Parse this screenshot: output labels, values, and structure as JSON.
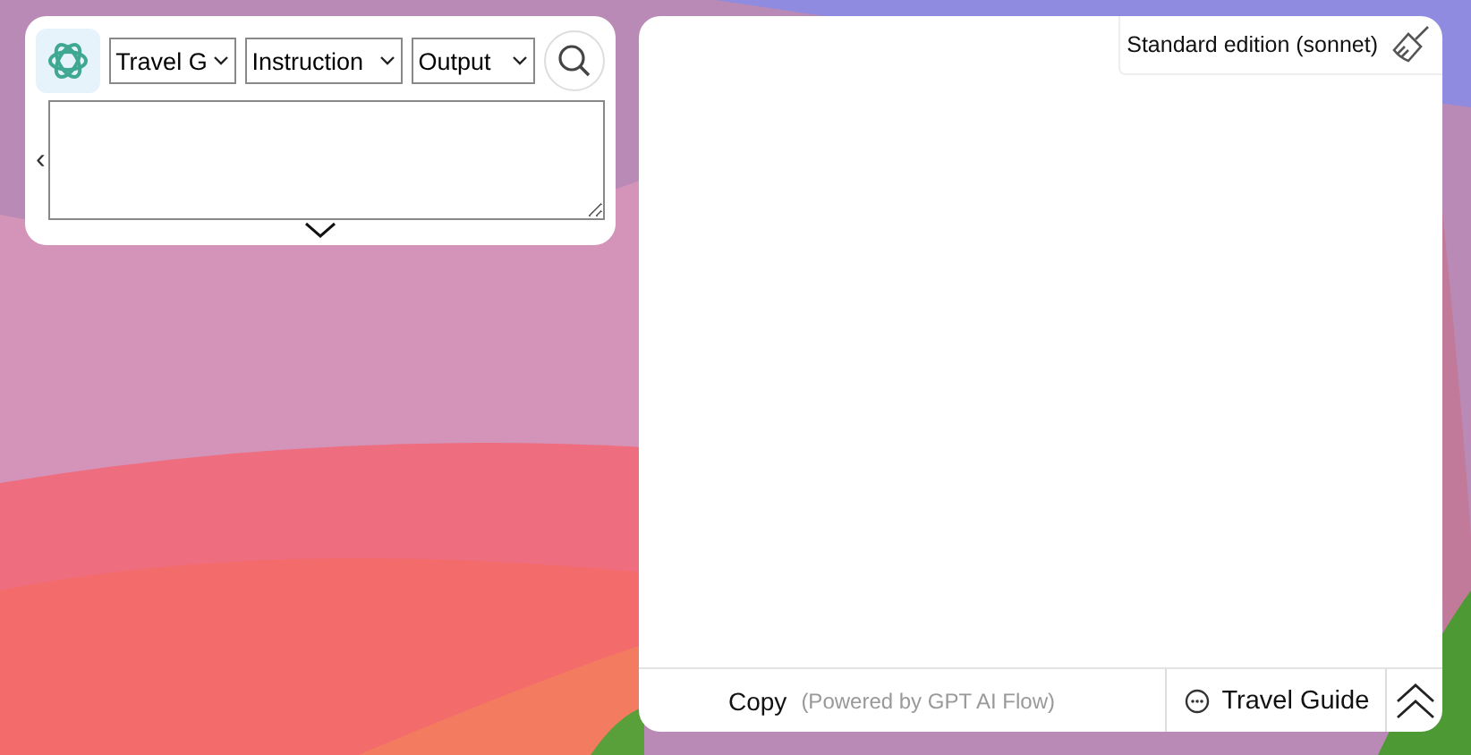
{
  "input_panel": {
    "selects": [
      {
        "value": "Travel G"
      },
      {
        "value": "Instruction"
      },
      {
        "value": "Output"
      }
    ],
    "back_glyph": "‹"
  },
  "output_panel": {
    "edition": "Standard edition (sonnet)",
    "footer": {
      "copy": "Copy",
      "powered_by": "(Powered by GPT AI Flow)",
      "assistant": "Travel Guide"
    }
  }
}
